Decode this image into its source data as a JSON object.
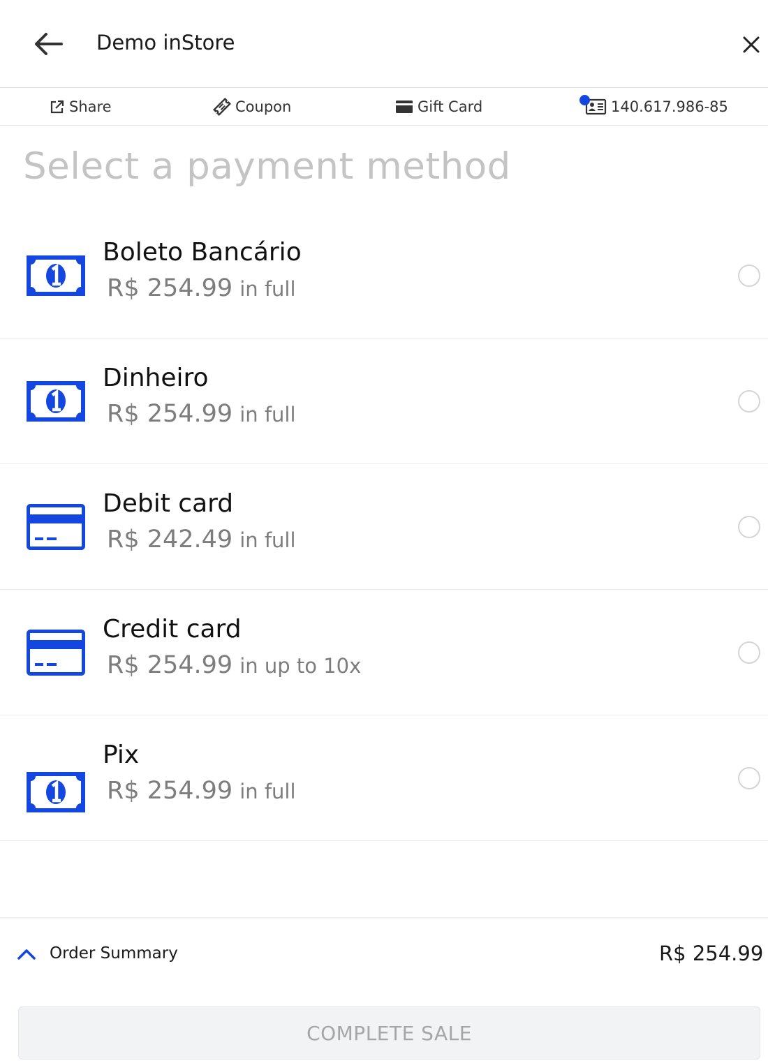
{
  "header": {
    "title": "Demo inStore",
    "back_icon": "arrow-left-icon",
    "close_icon": "close-icon"
  },
  "toolbar": {
    "share_label": "Share",
    "coupon_label": "Coupon",
    "gift_card_label": "Gift Card",
    "customer_id": "140.617.986-85",
    "notification_color": "#1447e0"
  },
  "main": {
    "heading": "Select a payment method",
    "methods": [
      {
        "name": "Boleto Bancário",
        "price": "R$ 254.99",
        "suffix": "in full",
        "icon": "cash-icon",
        "selected": false
      },
      {
        "name": "Dinheiro",
        "price": "R$ 254.99",
        "suffix": "in full",
        "icon": "cash-icon",
        "selected": false
      },
      {
        "name": "Debit card",
        "price": "R$ 242.49",
        "suffix": "in full",
        "icon": "card-icon",
        "selected": false
      },
      {
        "name": "Credit card",
        "price": "R$ 254.99",
        "suffix": "in up to 10x",
        "icon": "card-icon",
        "selected": false
      },
      {
        "name": "Pix",
        "price": "R$ 254.99",
        "suffix": "in full",
        "icon": "cash-icon",
        "selected": false
      }
    ]
  },
  "footer": {
    "summary_label": "Order Summary",
    "summary_total": "R$ 254.99",
    "complete_label": "COMPLETE SALE"
  },
  "colors": {
    "accent": "#1447e0",
    "heading": "#c4c4c4",
    "button_bg": "#f2f3f4",
    "button_text": "#a6a6a6"
  }
}
